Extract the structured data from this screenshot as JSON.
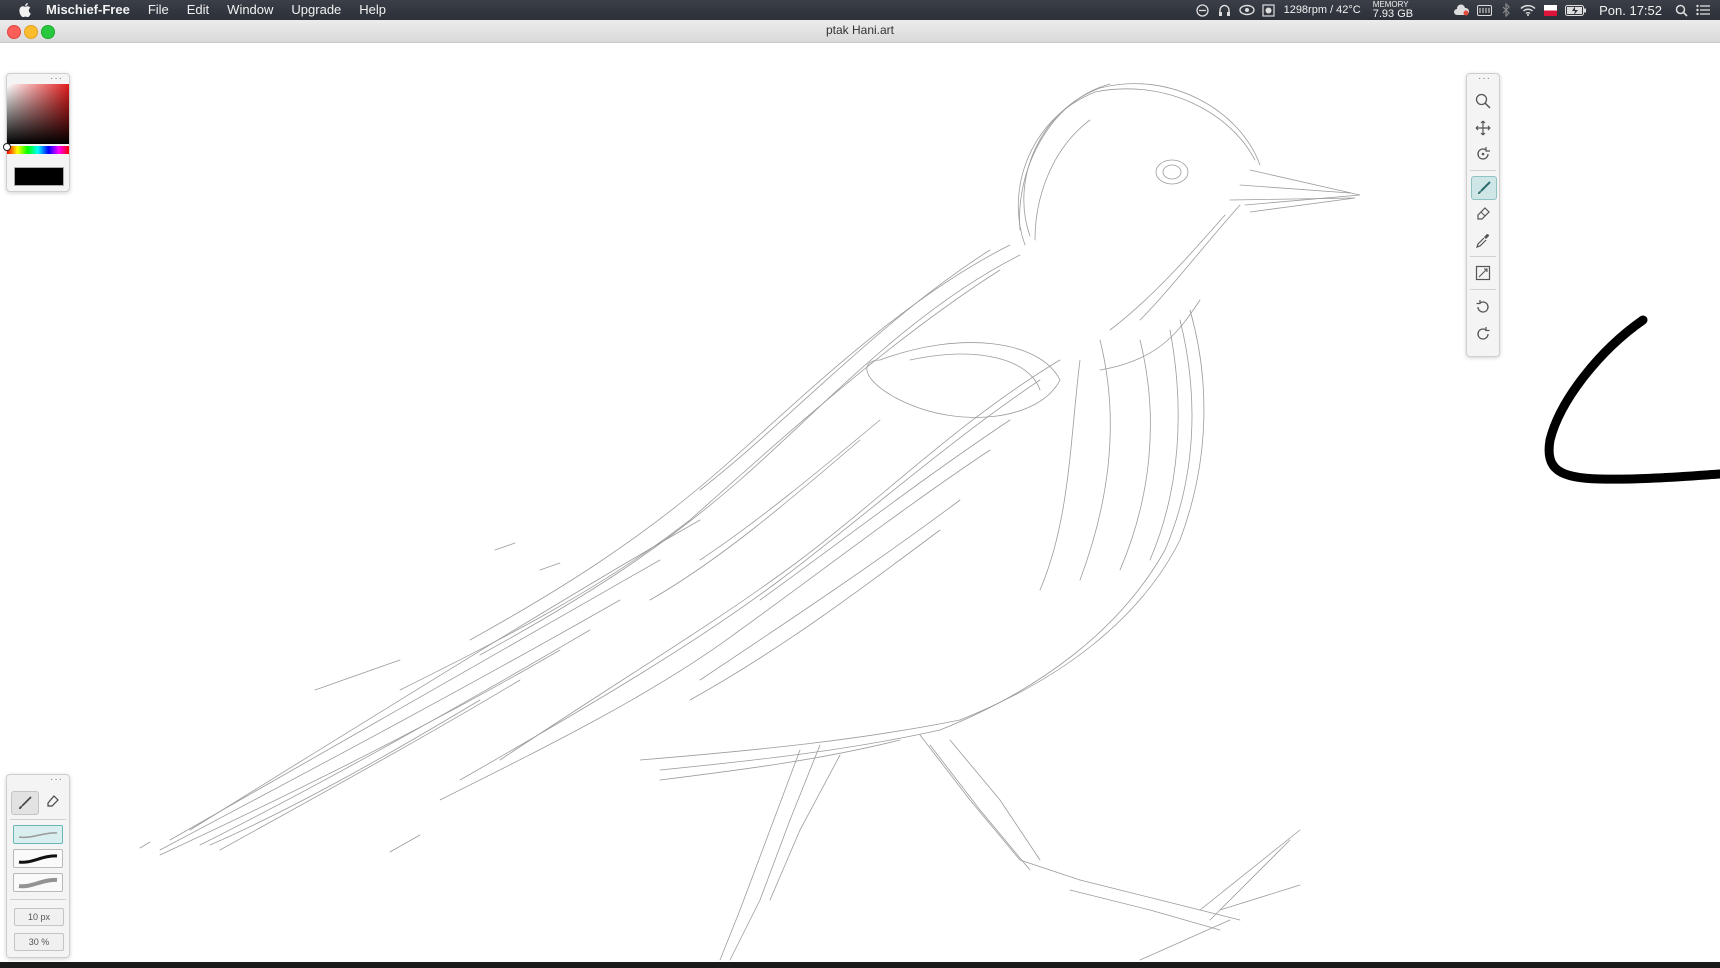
{
  "menubar": {
    "app_name": "Mischief-Free",
    "menus": [
      "File",
      "Edit",
      "Window",
      "Upgrade",
      "Help"
    ],
    "status": {
      "fan_temp": "1298rpm / 42°C",
      "memory_label": "MEMORY",
      "memory_value": "7.93 GB",
      "clock": "Pon. 17:52"
    }
  },
  "window": {
    "title": "ptak Hani.art"
  },
  "color_panel": {
    "current_color": "#000000",
    "hue": "red"
  },
  "toolbar": {
    "tools": [
      "zoom-icon",
      "pan-icon",
      "rotate-icon",
      "brush-icon",
      "eraser-icon",
      "eyedropper-icon",
      "canvas-size-icon",
      "undo-icon",
      "redo-icon"
    ],
    "active_tool": "brush-icon"
  },
  "brush_panel": {
    "size": "10 px",
    "opacity": "30 %",
    "selected_brush": 0,
    "active_mode": "brush"
  },
  "colors": {
    "accent": "#8fc3c3",
    "stroke": "#000000"
  }
}
